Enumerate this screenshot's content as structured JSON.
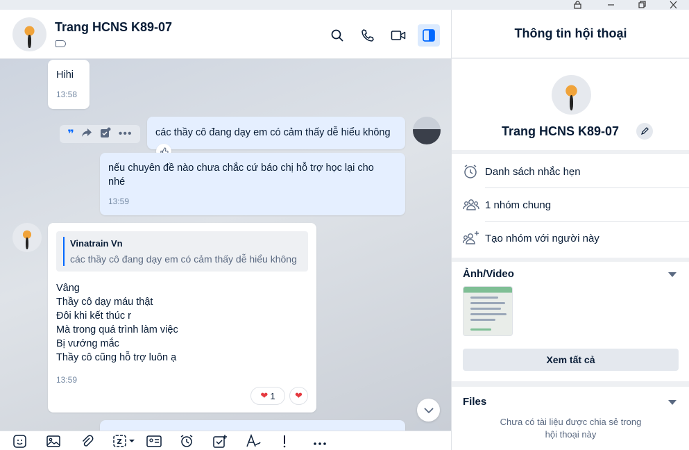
{
  "window": {
    "controls": [
      "lock-icon",
      "minimize-icon",
      "restore-icon",
      "close-icon"
    ]
  },
  "chat": {
    "contact_name": "Trang HCNS K89-07",
    "header_icons": [
      "search-icon",
      "phone-icon",
      "video-icon",
      "sidebar-toggle-icon"
    ],
    "messages": [
      {
        "id": "m1",
        "direction": "in",
        "text": "Hihi",
        "time": "13:58"
      },
      {
        "id": "m2",
        "direction": "out",
        "text": "các thầy cô đang dạy em có cảm thấy dễ hiểu không",
        "time": ""
      },
      {
        "id": "m3",
        "direction": "out",
        "text": "nếu chuyên đề nào chưa chắc cứ báo chị hỗ trợ học lại cho nhé",
        "time": "13:59"
      },
      {
        "id": "m4",
        "direction": "in",
        "quote": {
          "name": "Vinatrain Vn",
          "text": "các thầy cô đang dạy em có cảm thấy dễ hiểu không"
        },
        "lines": [
          "Vâng",
          "Thầy cô dạy máu thật",
          "Đôi khi kết thúc r",
          "Mà trong quá trình làm việc",
          "Bị vướng mắc",
          "Thầy cô cũng hỗ trợ luôn ạ"
        ],
        "time": "13:59",
        "reaction_count": "1"
      }
    ],
    "toolbar_icons": [
      "sticker-icon",
      "image-icon",
      "attach-icon",
      "zalo-format-icon",
      "contact-card-icon",
      "reminder-icon",
      "todo-icon",
      "text-format-icon",
      "priority-icon",
      "more-icon"
    ]
  },
  "panel": {
    "title": "Thông tin hội thoại",
    "name": "Trang HCNS K89-07",
    "rows": [
      {
        "label": "Danh sách nhắc hẹn",
        "icon": "alarm-icon"
      },
      {
        "label": "1 nhóm chung",
        "icon": "group-icon"
      },
      {
        "label": "Tạo nhóm với người này",
        "icon": "add-group-icon"
      }
    ],
    "media_title": "Ảnh/Video",
    "see_all": "Xem tất cả",
    "files_title": "Files",
    "files_empty": "Chưa có tài liệu được chia sẻ trong hội thoại này"
  },
  "colors": {
    "accent": "#0068ff",
    "outgoing_bubble": "#e5efff",
    "incoming_bubble": "#ffffff",
    "text": "#081c36"
  }
}
